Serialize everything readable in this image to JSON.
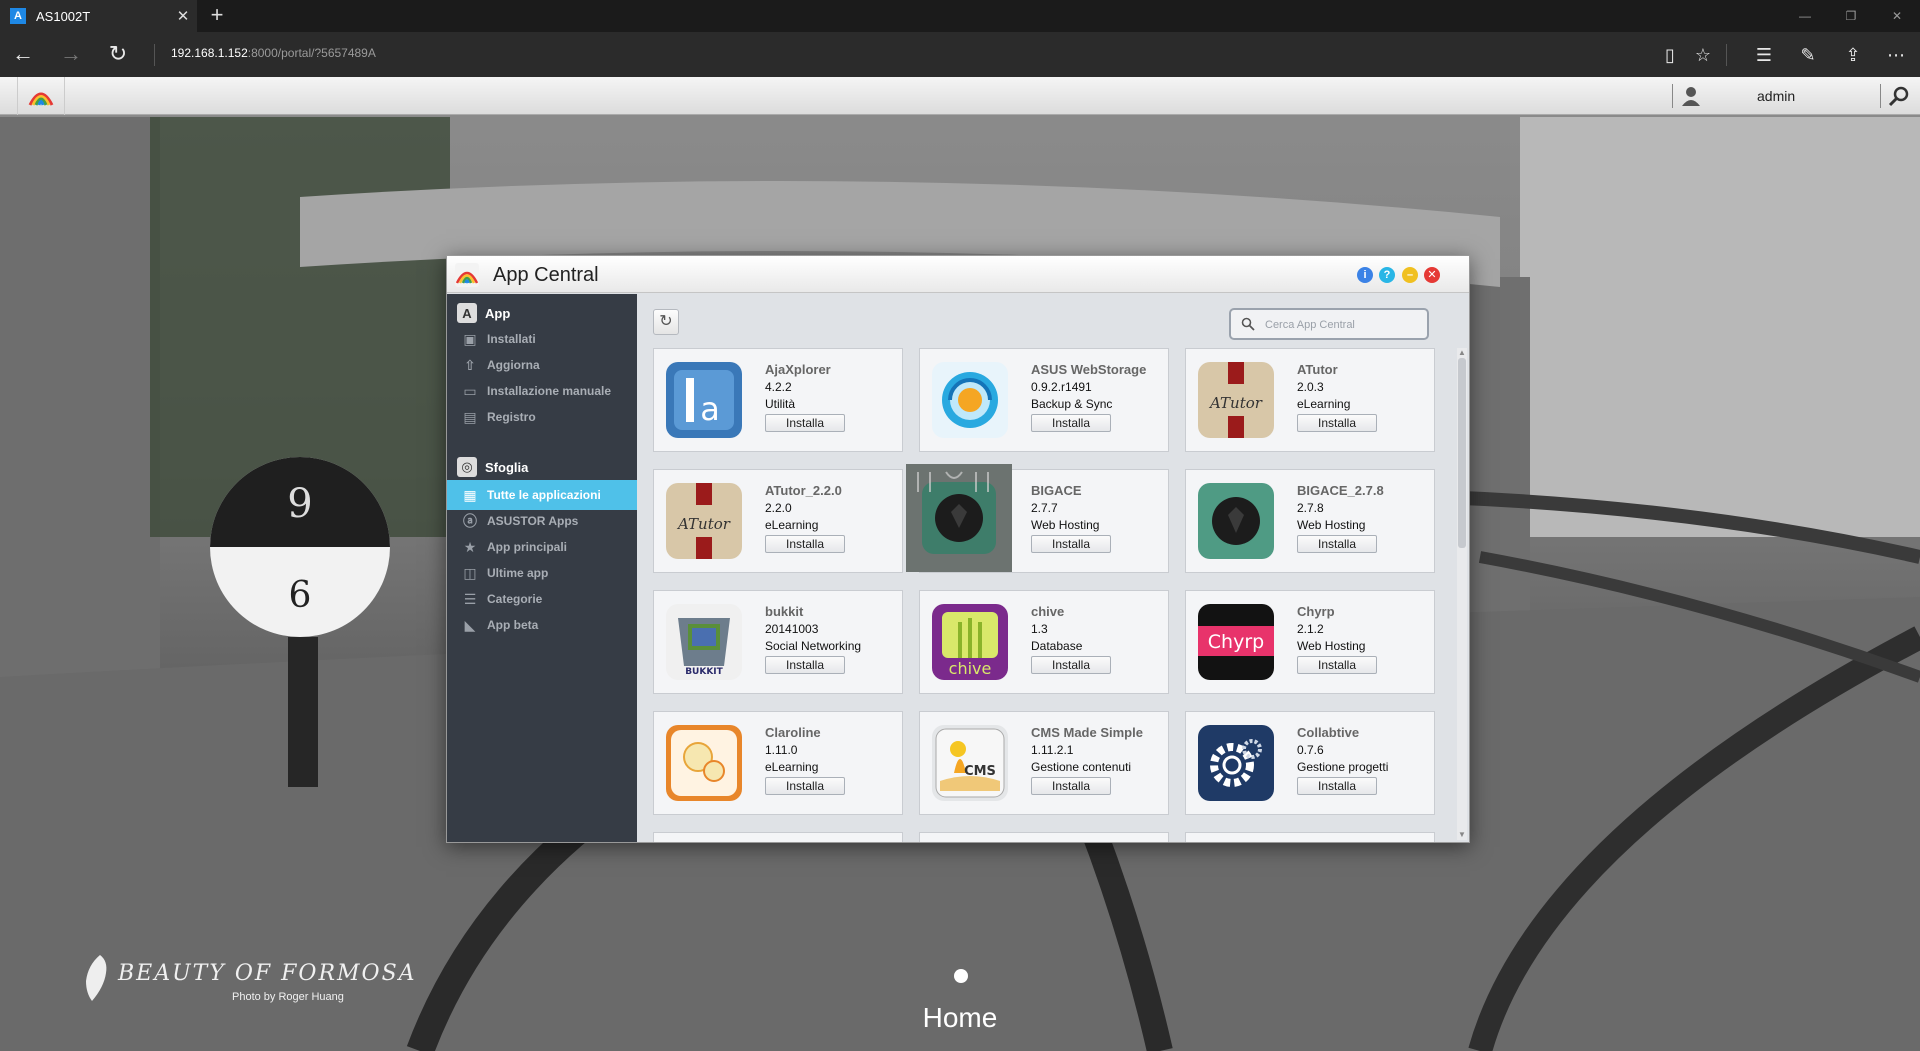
{
  "browser": {
    "tab_title": "AS1002T",
    "tab_favicon": "A",
    "url_host": "192.168.1.152",
    "url_path": ":8000/portal/?5657489A",
    "icons": [
      "back-arrow-icon",
      "forward-arrow-icon",
      "refresh-icon",
      "reading-view-icon",
      "favorite-star-icon",
      "hub-icon",
      "web-note-icon",
      "share-icon",
      "more-icon"
    ]
  },
  "nas": {
    "username": "admin",
    "branding_title": "BEAUTY OF FORMOSA",
    "branding_credit": "Photo by Roger Huang",
    "home_label": "Home"
  },
  "window": {
    "title": "App Central",
    "buttons": {
      "info": "i",
      "help": "?",
      "accent_info": "#3b82e6",
      "accent_help": "#29b6e6",
      "accent_min": "#f0c020",
      "accent_close": "#e53935"
    }
  },
  "sidebar": {
    "section_app": "App",
    "app_items": [
      {
        "label": "Installati",
        "icon": "installed-icon"
      },
      {
        "label": "Aggiorna",
        "icon": "upload-icon"
      },
      {
        "label": "Installazione manuale",
        "icon": "folder-open-icon"
      },
      {
        "label": "Registro",
        "icon": "log-icon"
      }
    ],
    "section_browse": "Sfoglia",
    "browse_items": [
      {
        "label": "Tutte le applicazioni",
        "icon": "grid-icon",
        "active": true
      },
      {
        "label": "ASUSTOR Apps",
        "icon": "asustor-icon",
        "active": false
      },
      {
        "label": "App principali",
        "icon": "star-icon",
        "active": false
      },
      {
        "label": "Ultime app",
        "icon": "new-icon",
        "active": false
      },
      {
        "label": "Categorie",
        "icon": "list-icon",
        "active": false
      },
      {
        "label": "App beta",
        "icon": "beta-icon",
        "active": false
      }
    ],
    "accent": "#4fc1e9"
  },
  "content": {
    "search_placeholder": "Cerca App Central",
    "install_label": "Installa",
    "apps": [
      {
        "name": "AjaXplorer",
        "version": "4.2.2",
        "category": "Utilità",
        "icon": "ajaxplorer-icon"
      },
      {
        "name": "ASUS WebStorage",
        "version": "0.9.2.r1491",
        "category": "Backup & Sync",
        "icon": "asus-webstorage-icon"
      },
      {
        "name": "ATutor",
        "version": "2.0.3",
        "category": "eLearning",
        "icon": "atutor-icon",
        "icon_text": "ATutor"
      },
      {
        "name": "ATutor_2.2.0",
        "version": "2.2.0",
        "category": "eLearning",
        "icon": "atutor-icon",
        "icon_text": "ATutor"
      },
      {
        "name": "BIGACE",
        "version": "2.7.7",
        "category": "Web Hosting",
        "icon": "bigace-icon"
      },
      {
        "name": "BIGACE_2.7.8",
        "version": "2.7.8",
        "category": "Web Hosting",
        "icon": "bigace-icon"
      },
      {
        "name": "bukkit",
        "version": "20141003",
        "category": "Social Networking",
        "icon": "bukkit-icon",
        "icon_text": "BUKKIT"
      },
      {
        "name": "chive",
        "version": "1.3",
        "category": "Database",
        "icon": "chive-icon",
        "icon_text": "chive"
      },
      {
        "name": "Chyrp",
        "version": "2.1.2",
        "category": "Web Hosting",
        "icon": "chyrp-icon",
        "icon_text": "Chyrp"
      },
      {
        "name": "Claroline",
        "version": "1.11.0",
        "category": "eLearning",
        "icon": "claroline-icon"
      },
      {
        "name": "CMS Made Simple",
        "version": "1.11.2.1",
        "category": "Gestione contenuti",
        "icon": "cms-made-simple-icon",
        "icon_text": "CMS"
      },
      {
        "name": "Collabtive",
        "version": "0.7.6",
        "category": "Gestione progetti",
        "icon": "collabtive-gear-icon"
      }
    ]
  }
}
